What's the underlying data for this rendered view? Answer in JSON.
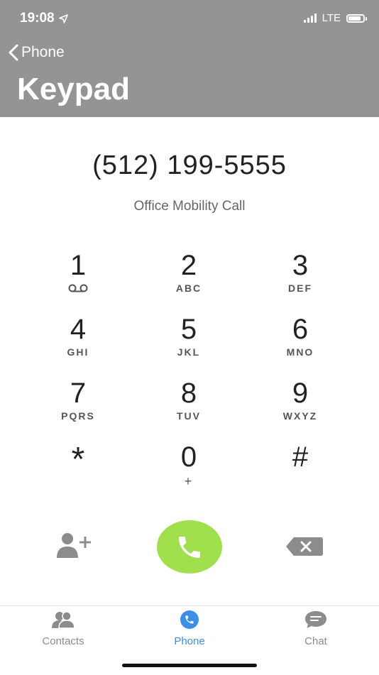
{
  "status_bar": {
    "time": "19:08",
    "network": "LTE",
    "battery_level": 0.75
  },
  "header": {
    "back_label": "Phone",
    "title": "Keypad"
  },
  "dialer": {
    "number": "(512) 199-5555",
    "call_type": "Office Mobility Call"
  },
  "keys": [
    {
      "digit": "1",
      "letters": ""
    },
    {
      "digit": "2",
      "letters": "ABC"
    },
    {
      "digit": "3",
      "letters": "DEF"
    },
    {
      "digit": "4",
      "letters": "GHI"
    },
    {
      "digit": "5",
      "letters": "JKL"
    },
    {
      "digit": "6",
      "letters": "MNO"
    },
    {
      "digit": "7",
      "letters": "PQRS"
    },
    {
      "digit": "8",
      "letters": "TUV"
    },
    {
      "digit": "9",
      "letters": "WXYZ"
    },
    {
      "digit": "*",
      "letters": ""
    },
    {
      "digit": "0",
      "letters": "+"
    },
    {
      "digit": "#",
      "letters": ""
    }
  ],
  "actions": {
    "add_contact_icon": "add-contact-icon",
    "call_icon": "phone-icon",
    "call_color": "#a0e04c",
    "backspace_icon": "backspace-icon"
  },
  "tabs": [
    {
      "label": "Contacts",
      "icon": "contacts-icon",
      "active": false
    },
    {
      "label": "Phone",
      "icon": "phone-icon",
      "active": true
    },
    {
      "label": "Chat",
      "icon": "chat-icon",
      "active": false
    }
  ],
  "colors": {
    "header": "#949494",
    "accent": "#3d8ee8",
    "call": "#a0e04c",
    "inactive": "#8c8c8c"
  }
}
